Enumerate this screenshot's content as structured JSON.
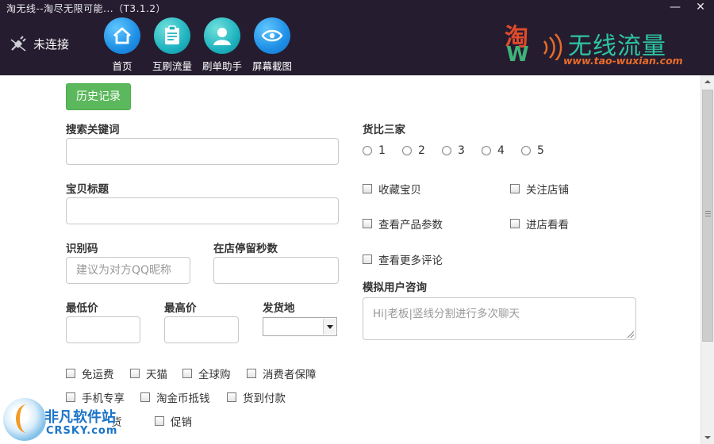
{
  "window": {
    "title": "淘无线--淘尽无限可能...（T3.1.2）",
    "minimize_glyph": "—",
    "close_glyph": "✕"
  },
  "header": {
    "connection_status": "未连接",
    "connection_icon": "plug-disconnected-icon",
    "nav": [
      {
        "label": "首页",
        "icon": "home-icon"
      },
      {
        "label": "互刷流量",
        "icon": "clipboard-icon"
      },
      {
        "label": "刷单助手",
        "icon": "user-icon"
      },
      {
        "label": "屏幕截图",
        "icon": "eye-icon"
      }
    ],
    "brand": {
      "mark_char": "淘",
      "mark_letter": "W",
      "name": "无线流量",
      "url": "www.tao-wuxian.com"
    }
  },
  "form": {
    "history_button": "历史记录",
    "keyword_label": "搜索关键词",
    "keyword_value": "",
    "title_label": "宝贝标题",
    "title_value": "",
    "idcode_label": "识别码",
    "idcode_placeholder": "建议为对方QQ昵称",
    "stay_label": "在店停留秒数",
    "stay_value": "",
    "min_price_label": "最低价",
    "max_price_label": "最高价",
    "ship_from_label": "发货地",
    "ship_from_value": "",
    "compare_label": "货比三家",
    "compare_options": [
      "1",
      "2",
      "3",
      "4",
      "5"
    ],
    "actions": [
      "收藏宝贝",
      "关注店铺",
      "查看产品参数",
      "进店看看",
      "查看更多评论"
    ],
    "consult_label": "模拟用户咨询",
    "consult_placeholder": "Hi|老板|竖线分割进行多次聊天",
    "filters_row1": [
      "免运费",
      "天猫",
      "全球购",
      "消费者保障"
    ],
    "filters_row2": [
      "手机专享",
      "淘金币抵钱",
      "货到付款"
    ],
    "filters_row3": [
      "货",
      "促销"
    ]
  },
  "watermark": {
    "cn": "非凡软件站",
    "en": "CRSKY.com"
  }
}
